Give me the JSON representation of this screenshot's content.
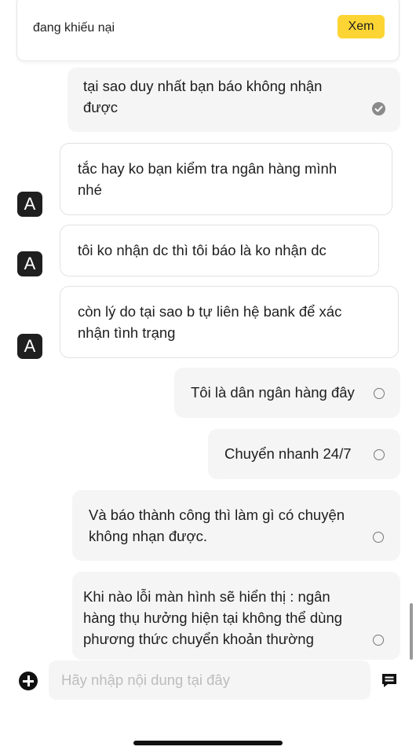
{
  "complaint_banner": {
    "text": "đang khiếu nại",
    "button_label": "Xem",
    "accent_color": "#fcd535"
  },
  "messages": [
    {
      "sender": "user",
      "lines": [
        "tại sao duy nhất bạn báo không nhận",
        "được"
      ],
      "status": "read"
    },
    {
      "sender": "agent",
      "avatar": "A",
      "lines": [
        "tắc hay ko bạn kiểm tra ngân hàng mình",
        "nhé"
      ]
    },
    {
      "sender": "agent",
      "avatar": "A",
      "lines": [
        "tôi ko nhận dc thì tôi báo là ko nhận dc"
      ]
    },
    {
      "sender": "agent",
      "avatar": "A",
      "lines": [
        "còn lý do tại sao b tự liên hệ bank để xác",
        "nhận tình trạng"
      ]
    },
    {
      "sender": "user",
      "lines": [
        "Tôi là dân ngân hàng đây"
      ],
      "status": "sent"
    },
    {
      "sender": "user",
      "lines": [
        "Chuyển nhanh 24/7"
      ],
      "status": "sent"
    },
    {
      "sender": "user",
      "lines": [
        "Và báo thành công thì làm gì có chuyện",
        "không nhạn được."
      ],
      "status": "sent"
    },
    {
      "sender": "user",
      "lines": [
        "Khi nào lỗi màn hình sẽ hiển thị : ngân",
        "hàng thụ hưởng hiện tại không thể dùng",
        "phương thức chuyển khoản thường"
      ],
      "status": "sent"
    }
  ],
  "composer": {
    "placeholder": "Hãy nhập nội dung tại đây",
    "add_icon": "plus-circle-icon",
    "send_icon": "message-icon"
  }
}
